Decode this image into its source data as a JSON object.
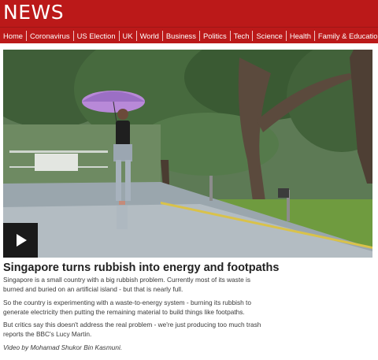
{
  "header": {
    "logo": "NEWS"
  },
  "nav": {
    "items": [
      {
        "label": "Home"
      },
      {
        "label": "Coronavirus"
      },
      {
        "label": "US Election"
      },
      {
        "label": "UK"
      },
      {
        "label": "World"
      },
      {
        "label": "Business"
      },
      {
        "label": "Politics"
      },
      {
        "label": "Tech"
      },
      {
        "label": "Science"
      },
      {
        "label": "Health"
      },
      {
        "label": "Family & Education"
      }
    ]
  },
  "video": {
    "play_icon": "play-icon",
    "colors": {
      "accent": "#bb1919",
      "play_bg": "#1a1a1a"
    }
  },
  "article": {
    "headline": "Singapore turns rubbish into energy and footpaths",
    "paragraphs": [
      "Singapore is a small country with a big rubbish problem. Currently most of its waste is burned and buried on an artificial island - but that is nearly full.",
      "So the country is experimenting with a waste-to-energy system - burning its rubbish to generate electricity then putting the remaining material to build things like footpaths.",
      "But critics say this doesn't address the real problem - we're just producing too much trash reports the BBC's Lucy Martin."
    ],
    "credit": "Video by Mohamad Shukor Bin Kasmuni."
  }
}
